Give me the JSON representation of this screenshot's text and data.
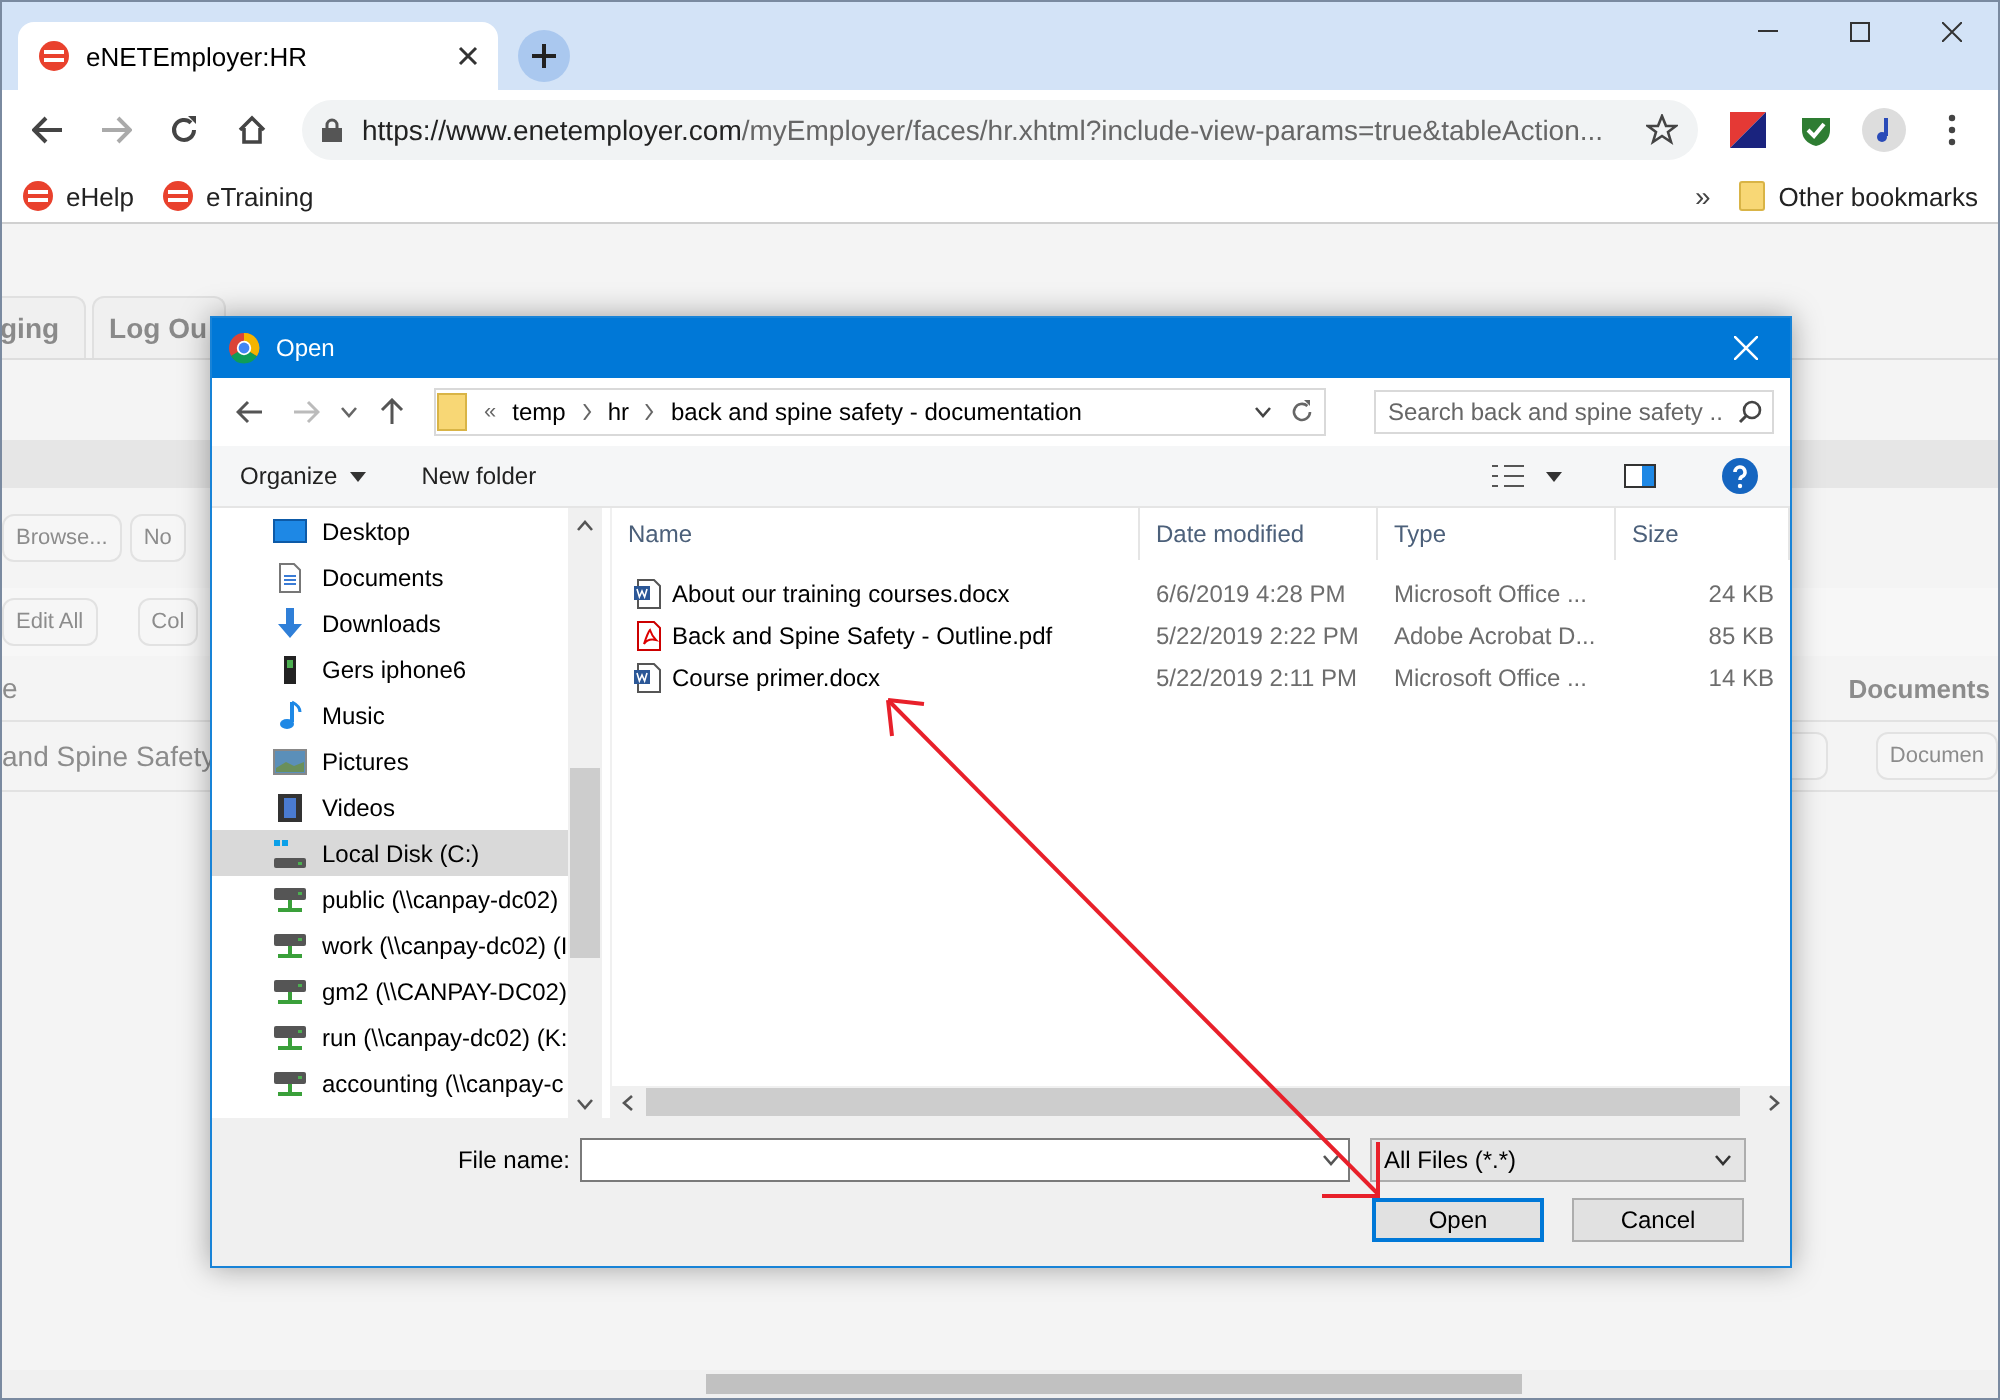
{
  "browser": {
    "tab_title": "eNETEmployer:HR",
    "url_host": "https://www.enetemployer.com",
    "url_path": "/myEmployer/faces/hr.xhtml?include-view-params=true&tableAction...",
    "bookmarks": [
      "eHelp",
      "eTraining"
    ],
    "more": "»",
    "other_bookmarks": "Other bookmarks"
  },
  "page": {
    "tabs": [
      "ging",
      "Log Ou"
    ],
    "browse_button": "Browse...",
    "file_field": "No",
    "buttons": [
      "Edit All",
      "Col"
    ],
    "column_1": "e",
    "column_2": "Documents",
    "row_cell": "and Spine Safety",
    "row_button": "Documen"
  },
  "dialog": {
    "title": "Open",
    "path_prefix": "«",
    "path": [
      "temp",
      "hr",
      "back and spine safety - documentation"
    ],
    "search": {
      "placeholder": "Search back and spine safety ..."
    },
    "commands": [
      "Organize",
      "New folder"
    ],
    "nav_items": [
      {
        "label": "Desktop",
        "kind": "desktop",
        "selected": false
      },
      {
        "label": "Documents",
        "kind": "documents",
        "selected": false
      },
      {
        "label": "Downloads",
        "kind": "downloads",
        "selected": false
      },
      {
        "label": "Gers iphone6",
        "kind": "phone",
        "selected": false
      },
      {
        "label": "Music",
        "kind": "music",
        "selected": false
      },
      {
        "label": "Pictures",
        "kind": "pictures",
        "selected": false
      },
      {
        "label": "Videos",
        "kind": "videos",
        "selected": false
      },
      {
        "label": "Local Disk (C:)",
        "kind": "disk",
        "selected": true
      },
      {
        "label": "public (\\\\canpay-dc02)",
        "kind": "network",
        "selected": false
      },
      {
        "label": "work (\\\\canpay-dc02) (I",
        "kind": "network",
        "selected": false
      },
      {
        "label": "gm2 (\\\\CANPAY-DC02)",
        "kind": "network",
        "selected": false
      },
      {
        "label": "run (\\\\canpay-dc02) (K:",
        "kind": "network",
        "selected": false
      },
      {
        "label": "accounting (\\\\canpay-c",
        "kind": "network",
        "selected": false
      }
    ],
    "columns": [
      "Name",
      "Date modified",
      "Type",
      "Size"
    ],
    "files": [
      {
        "name": "About our training courses.docx",
        "kind": "docx",
        "date": "6/6/2019 4:28 PM",
        "type": "Microsoft Office ...",
        "size": "24 KB"
      },
      {
        "name": "Back and Spine Safety - Outline.pdf",
        "kind": "pdf",
        "date": "5/22/2019 2:22 PM",
        "type": "Adobe Acrobat D...",
        "size": "85 KB"
      },
      {
        "name": "Course primer.docx",
        "kind": "docx",
        "date": "5/22/2019 2:11 PM",
        "type": "Microsoft Office ...",
        "size": "14 KB"
      }
    ],
    "file_name_label": "File name:",
    "file_type": "All Files (*.*)",
    "buttons": [
      "Open",
      "Cancel"
    ]
  }
}
